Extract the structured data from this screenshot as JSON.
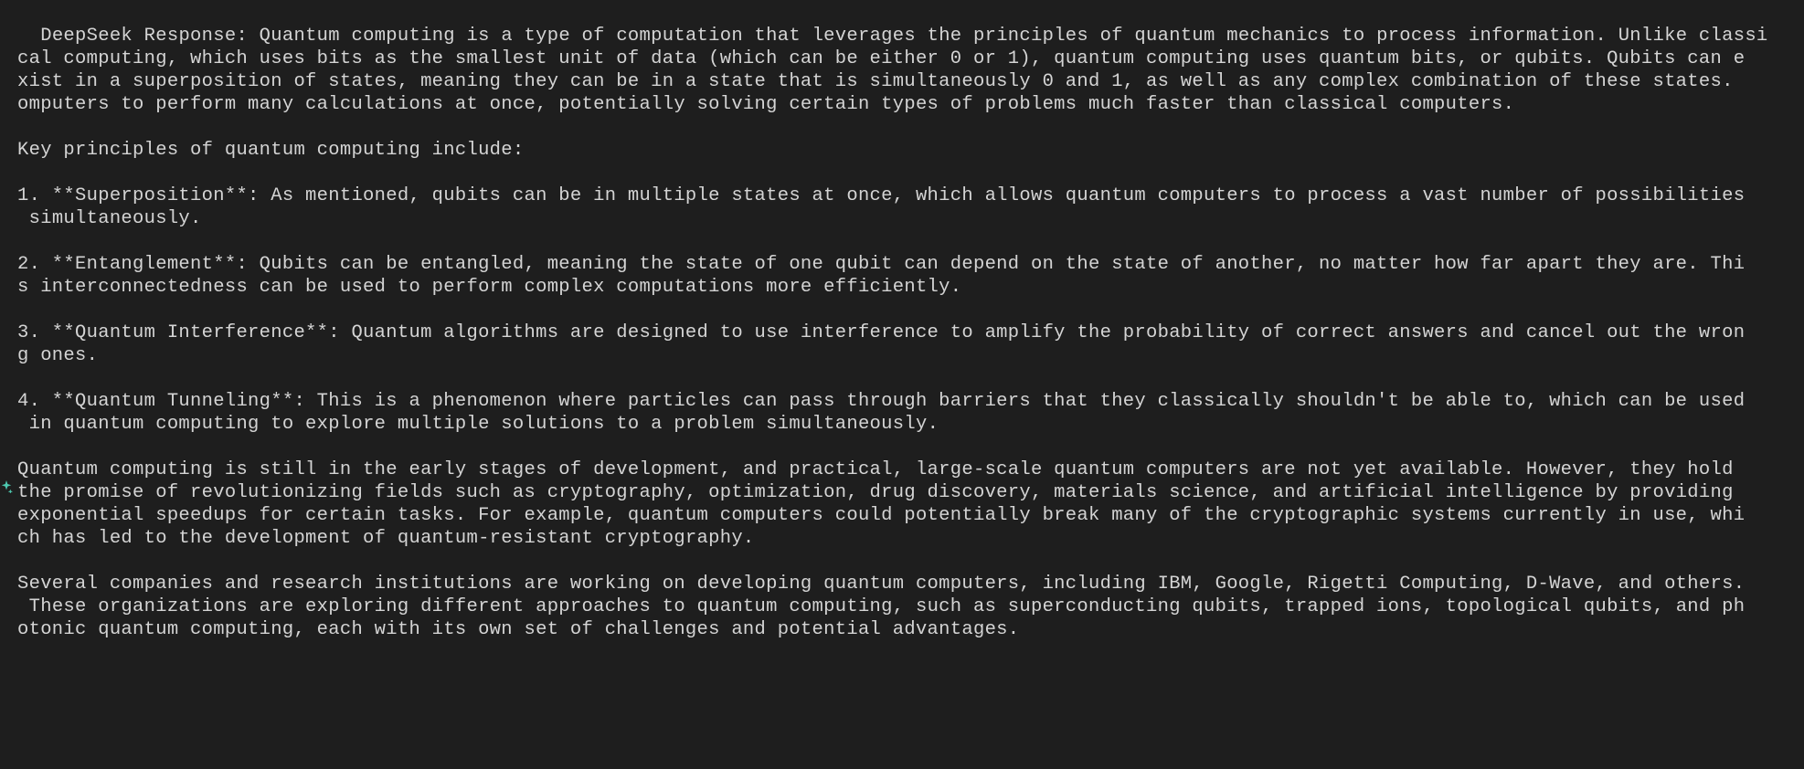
{
  "terminal": {
    "response_prefix": "DeepSeek Response: ",
    "content": "Quantum computing is a type of computation that leverages the principles of quantum mechanics to process information. Unlike classi\ncal computing, which uses bits as the smallest unit of data (which can be either 0 or 1), quantum computing uses quantum bits, or qubits. Qubits can e\nxist in a superposition of states, meaning they can be in a state that is simultaneously 0 and 1, as well as any complex combination of these states.\nomputers to perform many calculations at once, potentially solving certain types of problems much faster than classical computers.\n\nKey principles of quantum computing include:\n\n1. **Superposition**: As mentioned, qubits can be in multiple states at once, which allows quantum computers to process a vast number of possibilities\n simultaneously.\n\n2. **Entanglement**: Qubits can be entangled, meaning the state of one qubit can depend on the state of another, no matter how far apart they are. Thi\ns interconnectedness can be used to perform complex computations more efficiently.\n\n3. **Quantum Interference**: Quantum algorithms are designed to use interference to amplify the probability of correct answers and cancel out the wron\ng ones.\n\n4. **Quantum Tunneling**: This is a phenomenon where particles can pass through barriers that they classically shouldn't be able to, which can be used\n in quantum computing to explore multiple solutions to a problem simultaneously.\n\nQuantum computing is still in the early stages of development, and practical, large-scale quantum computers are not yet available. However, they hold\nthe promise of revolutionizing fields such as cryptography, optimization, drug discovery, materials science, and artificial intelligence by providing\nexponential speedups for certain tasks. For example, quantum computers could potentially break many of the cryptographic systems currently in use, whi\nch has led to the development of quantum-resistant cryptography.\n\nSeveral companies and research institutions are working on developing quantum computers, including IBM, Google, Rigetti Computing, D-Wave, and others.\n These organizations are exploring different approaches to quantum computing, such as superconducting qubits, trapped ions, topological qubits, and ph\notonic quantum computing, each with its own set of challenges and potential advantages."
  },
  "gutter_icon": "✧"
}
